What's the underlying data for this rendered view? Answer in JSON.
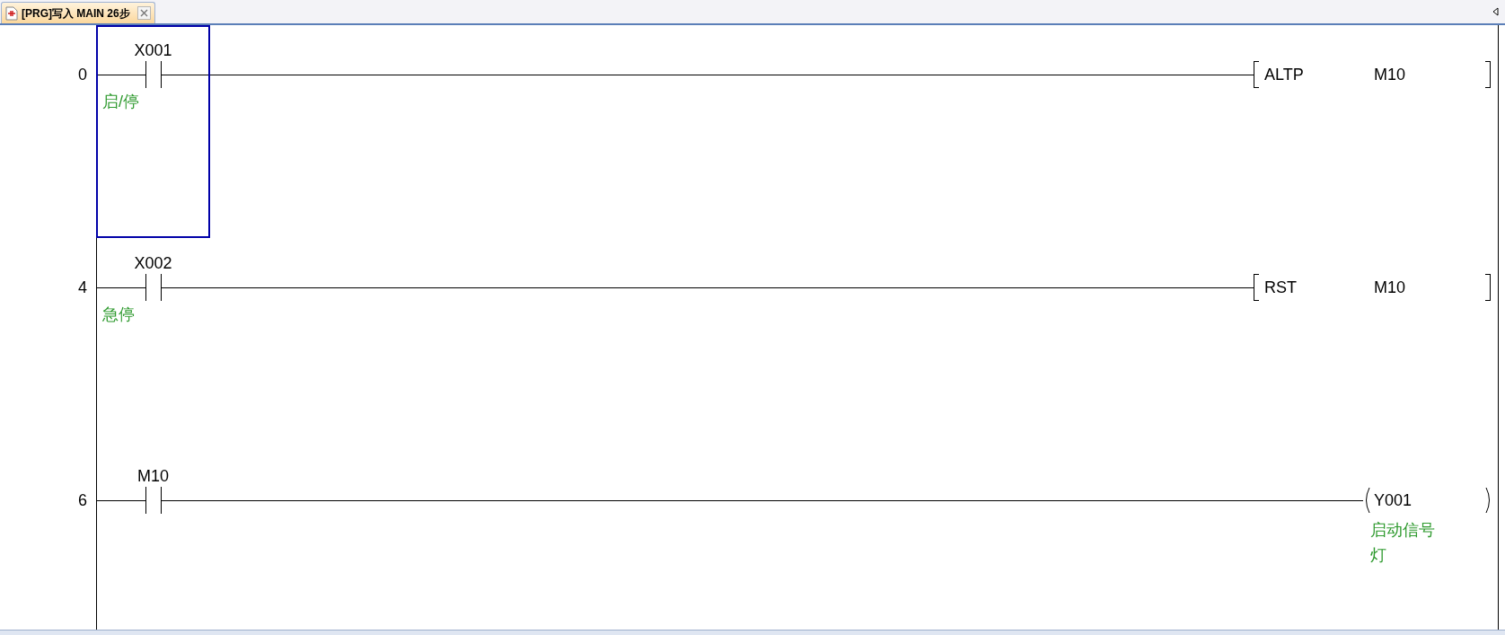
{
  "tab": {
    "title": "[PRG]写入 MAIN 26步",
    "selected": true
  },
  "rungs": [
    {
      "step": "0",
      "contacts": [
        {
          "kind": "no_contact",
          "device": "X001",
          "comment": "启/停",
          "selected": true
        }
      ],
      "output": {
        "kind": "instruction",
        "mnemonic": "ALTP",
        "operand": "M10"
      }
    },
    {
      "step": "4",
      "contacts": [
        {
          "kind": "no_contact",
          "device": "X002",
          "comment": "急停",
          "selected": false
        }
      ],
      "output": {
        "kind": "instruction",
        "mnemonic": "RST",
        "operand": "M10"
      }
    },
    {
      "step": "6",
      "contacts": [
        {
          "kind": "no_contact",
          "device": "M10",
          "selected": false
        }
      ],
      "output": {
        "kind": "coil",
        "device": "Y001",
        "comment": "启动信号灯"
      }
    }
  ]
}
